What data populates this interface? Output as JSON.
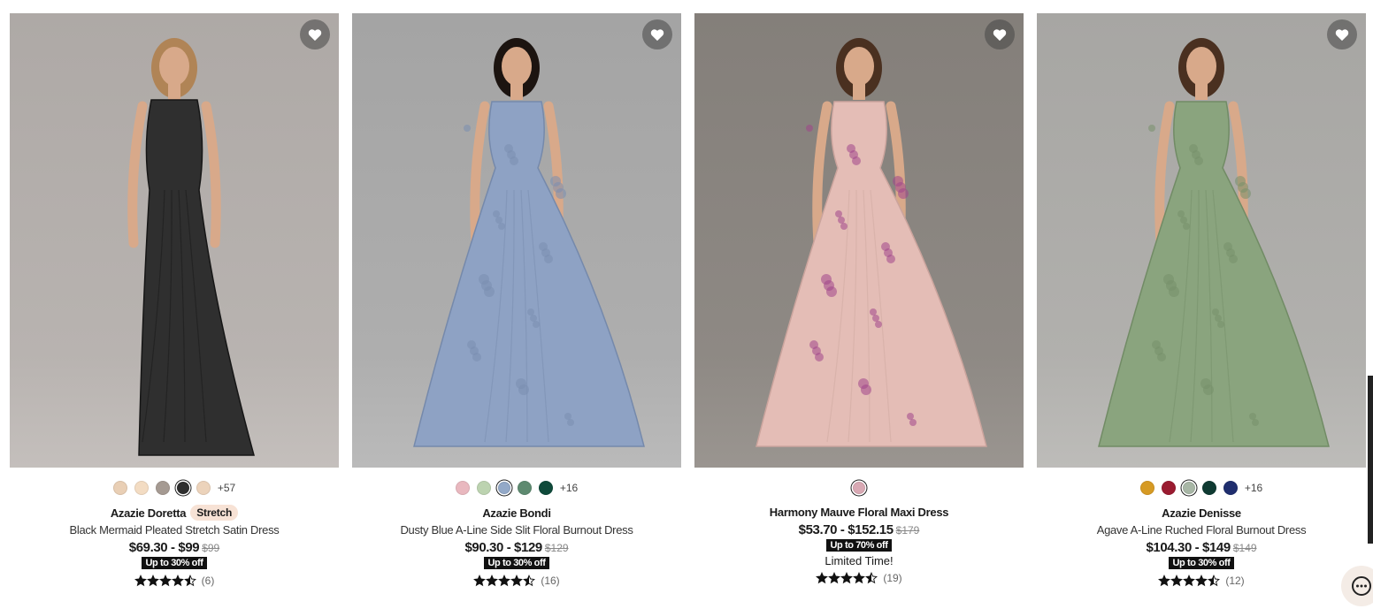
{
  "products": [
    {
      "brand": "Azazie Doretta",
      "tag": "Stretch",
      "description": "Black Mermaid Pleated Stretch Satin Dress",
      "price": "$69.30 - $99",
      "old_price": "$99",
      "badge": "Up to 30% off",
      "limited": "",
      "rating": 4.5,
      "review_count": "(6)",
      "more_colors": "+57",
      "swatches": [
        "#e9cfb5",
        "#f3dcc3",
        "#a59a92",
        "#2e2e2e",
        "#ecd3bb"
      ],
      "selected_swatch": 3,
      "dress_color": "#2f2f2f",
      "bg_color": "#b8b3b0"
    },
    {
      "brand": "Azazie Bondi",
      "tag": "",
      "description": "Dusty Blue A-Line Side Slit Floral Burnout Dress",
      "price": "$90.30 - $129",
      "old_price": "$129",
      "badge": "Up to 30% off",
      "limited": "",
      "rating": 4.5,
      "review_count": "(16)",
      "more_colors": "+16",
      "swatches": [
        "#e9b8bf",
        "#bcd3b0",
        "#93a9c8",
        "#5e8a70",
        "#0f4a3a"
      ],
      "selected_swatch": 2,
      "dress_color": "#8ea2c4",
      "bg_color": "#aeaeae"
    },
    {
      "brand": "Harmony Mauve Floral Maxi Dress",
      "tag": "",
      "description": "",
      "price": "$53.70 - $152.15",
      "old_price": "$179",
      "badge": "Up to 70% off",
      "limited": "Limited Time!",
      "rating": 4.5,
      "review_count": "(19)",
      "more_colors": "",
      "swatches": [
        "#d9a9b4"
      ],
      "selected_swatch": 0,
      "dress_color": "#e4bdb6",
      "bg_color": "#8e8984"
    },
    {
      "brand": "Azazie Denisse",
      "tag": "",
      "description": "Agave A-Line Ruched Floral Burnout Dress",
      "price": "$104.30 - $149",
      "old_price": "$149",
      "badge": "Up to 30% off",
      "limited": "",
      "rating": 4.5,
      "review_count": "(12)",
      "more_colors": "+16",
      "swatches": [
        "#d69a24",
        "#9a1b30",
        "#a8b7a6",
        "#0f3a32",
        "#1f2e6e"
      ],
      "selected_swatch": 2,
      "dress_color": "#8aa47e",
      "bg_color": "#b1b0ad"
    }
  ],
  "icons": {
    "wishlist": "heart-icon",
    "chat": "chat-bubble-icon",
    "rating": "star-icon"
  }
}
